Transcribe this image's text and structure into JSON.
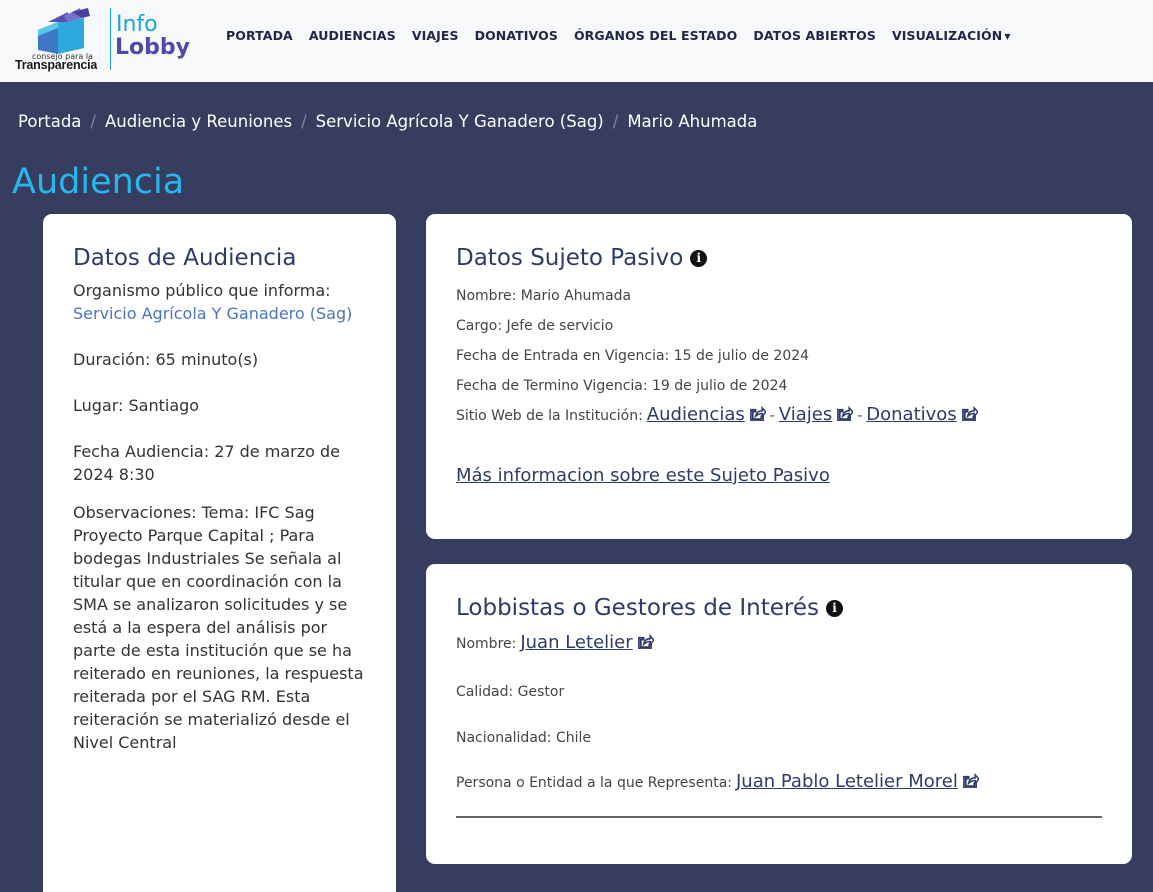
{
  "brand": {
    "cpt_small": "consejo para la",
    "cpt_big": "Transparencia",
    "info": "Info",
    "lobby": "Lobby"
  },
  "nav": {
    "items": [
      {
        "label": "PORTADA"
      },
      {
        "label": "AUDIENCIAS"
      },
      {
        "label": "VIAJES"
      },
      {
        "label": "DONATIVOS"
      },
      {
        "label": "ÓRGANOS DEL ESTADO"
      },
      {
        "label": "DATOS ABIERTOS"
      },
      {
        "label": "VISUALIZACIÓN"
      }
    ]
  },
  "breadcrumb": {
    "items": [
      "Portada",
      "Audiencia y Reuniones",
      "Servicio Agrícola Y Ganadero (Sag)",
      "Mario Ahumada"
    ]
  },
  "page": {
    "title": "Audiencia"
  },
  "audiencia": {
    "title": "Datos de Audiencia",
    "organismo_label": "Organismo público que informa:",
    "organismo_value": "Servicio Agrícola Y Ganadero (Sag)",
    "duracion": "Duración: 65 minuto(s)",
    "lugar": "Lugar: Santiago",
    "fecha": "Fecha Audiencia: 27 de marzo de 2024 8:30",
    "observaciones": "Observaciones: Tema: IFC Sag Proyecto Parque Capital ; Para bodegas Industriales Se señala al titular que en coordinación con la SMA se analizaron solicitudes y se está a la espera del análisis por parte de esta institución que se ha reiterado en reuniones, la respuesta reiterada por el SAG RM. Esta reiteración se materializó desde el Nivel Central"
  },
  "sujeto": {
    "title": "Datos Sujeto Pasivo",
    "nombre": "Nombre: Mario Ahumada",
    "cargo": "Cargo: Jefe de servicio",
    "fecha_entrada": "Fecha de Entrada en Vigencia: 15 de julio de 2024",
    "fecha_termino": "Fecha de Termino Vigencia: 19 de julio de 2024",
    "sitio_label": "Sitio Web de la Institución:",
    "link_audiencias": "Audiencias",
    "link_viajes": "Viajes",
    "link_donativos": "Donativos",
    "dash": "-",
    "mas_info": "Más informacion sobre este Sujeto Pasivo"
  },
  "lobbistas": {
    "title": "Lobbistas o Gestores de Interés",
    "nombre_label": "Nombre:",
    "nombre_value": "Juan Letelier",
    "calidad": "Calidad: Gestor",
    "nacionalidad": "Nacionalidad: Chile",
    "representa_label": "Persona o Entidad a la que Representa:",
    "representa_value": "Juan Pablo Letelier Morel"
  },
  "icons": {
    "info": "info-circle-icon",
    "external": "share-square-icon",
    "caret": "caret-down-icon"
  },
  "colors": {
    "background": "#363d5f",
    "accent": "#29b6ec",
    "title": "#2e3a68",
    "link": "#4a73c2"
  }
}
